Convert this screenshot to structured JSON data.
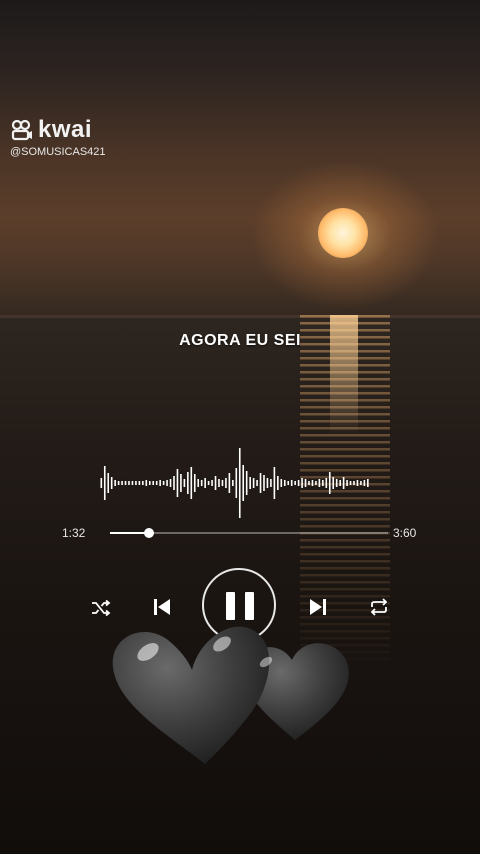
{
  "watermark": {
    "brand": "kwai",
    "handle": "@SOMUSICAS421"
  },
  "lyric": "AGORA EU SEI",
  "player": {
    "current_time": "1:32",
    "total_time": "3:60",
    "progress": 0.14,
    "controls": [
      "shuffle-icon",
      "previous-icon",
      "pause-icon",
      "next-icon",
      "repeat-icon"
    ]
  },
  "sticker": "black-hearts-icon",
  "colors": {
    "sun": "#ffe3a6",
    "heart": "#4a4a4a",
    "text": "#ffffff"
  }
}
